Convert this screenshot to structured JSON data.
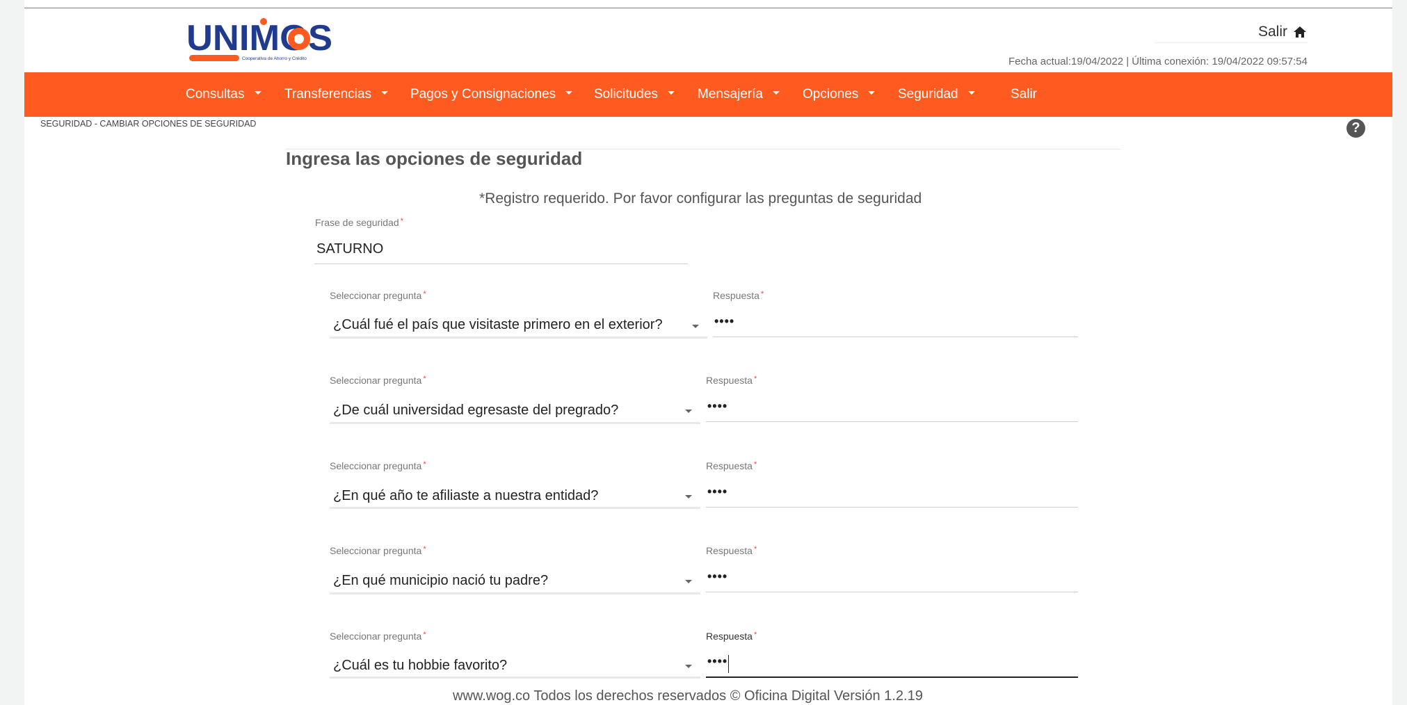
{
  "header": {
    "logo_text": "UNIMOS",
    "logo_tagline": "Cooperativa de Ahorro y Crédito",
    "exit_label": "Salir",
    "date_info": "Fecha actual:19/04/2022 | Última conexión: 19/04/2022 09:57:54"
  },
  "nav": {
    "items": [
      "Consultas",
      "Transferencias",
      "Pagos y Consignaciones",
      "Solicitudes",
      "Mensajería",
      "Opciones",
      "Seguridad",
      "Salir"
    ]
  },
  "breadcrumb": "SEGURIDAD - CAMBIAR OPCIONES DE SEGURIDAD",
  "page": {
    "title": "Ingresa las opciones de seguridad",
    "notice": "*Registro requerido. Por favor configurar las preguntas de seguridad",
    "phrase_label": "Frase de seguridad",
    "phrase_value": "SATURNO",
    "required_mark": "*"
  },
  "questions": [
    {
      "select_label": "Seleccionar pregunta",
      "question": "¿Cuál fué el país que visitaste primero en el exterior?",
      "answer_label": "Respuesta",
      "answer": "••••"
    },
    {
      "select_label": "Seleccionar pregunta",
      "question": "¿De cuál universidad egresaste del pregrado?",
      "answer_label": "Respuesta",
      "answer": "••••"
    },
    {
      "select_label": "Seleccionar pregunta",
      "question": "¿En qué año te afiliaste a nuestra entidad?",
      "answer_label": "Respuesta",
      "answer": "••••"
    },
    {
      "select_label": "Seleccionar pregunta",
      "question": "¿En qué municipio nació tu padre?",
      "answer_label": "Respuesta",
      "answer": "••••"
    },
    {
      "select_label": "Seleccionar pregunta",
      "question": "¿Cuál es tu hobbie favorito?",
      "answer_label": "Respuesta",
      "answer": "••••"
    }
  ],
  "footer": "www.wog.co Todos los derechos reservados © Oficina Digital Versión 1.2.19",
  "colors": {
    "brand_orange": "#ff5a1f",
    "brand_blue": "#1f3a8f"
  }
}
